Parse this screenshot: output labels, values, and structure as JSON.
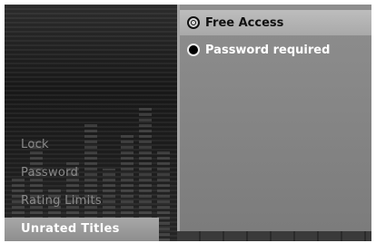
{
  "menu": {
    "items": [
      {
        "label": "Lock"
      },
      {
        "label": "Password"
      },
      {
        "label": "Rating Limits"
      },
      {
        "label": "Unrated Titles",
        "active": true
      }
    ]
  },
  "panel": {
    "options": [
      {
        "label": "Free Access",
        "selected": true
      },
      {
        "label": "Password required",
        "selected": false
      }
    ]
  },
  "colors": {
    "background": "#161616",
    "panel": "#868686",
    "highlight": "#b3b3b3",
    "menu_text": "#8a8a8a",
    "active_text": "#ffffff"
  },
  "icons": {
    "selected_radio": "radio-selected-icon",
    "unselected_radio": "radio-unselected-icon"
  }
}
